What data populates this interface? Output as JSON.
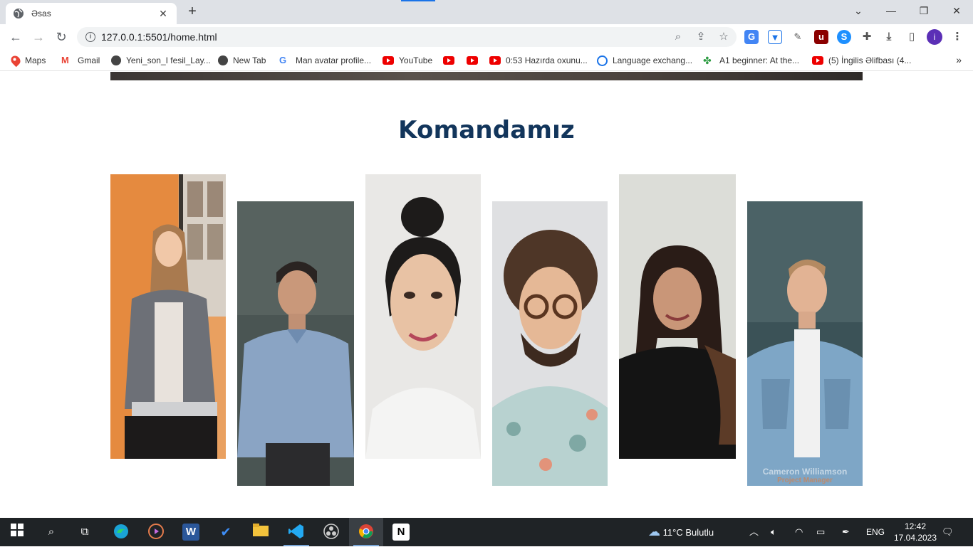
{
  "browser": {
    "tab_title": "Əsas",
    "url": "127.0.0.1:5501/home.html",
    "profile_initial": "i"
  },
  "bookmarks": [
    {
      "label": "Maps",
      "icon": "maps-icon"
    },
    {
      "label": "Gmail",
      "icon": "gmail-icon"
    },
    {
      "label": "Yeni_son_I fesil_Lay...",
      "icon": "globe-icon"
    },
    {
      "label": "New Tab",
      "icon": "globe-icon"
    },
    {
      "label": "Man avatar profile...",
      "icon": "google-icon"
    },
    {
      "label": "YouTube",
      "icon": "youtube-icon"
    },
    {
      "label": "",
      "icon": "youtube-icon"
    },
    {
      "label": "",
      "icon": "youtube-icon"
    },
    {
      "label": "0:53 Hazırda oxunu...",
      "icon": "youtube-icon"
    },
    {
      "label": "Language exchang...",
      "icon": "chat-icon"
    },
    {
      "label": "A1 beginner: At the...",
      "icon": "clover-icon"
    },
    {
      "label": "(5) İngilis Əlifbası (4...",
      "icon": "youtube-icon"
    }
  ],
  "page": {
    "section_title": "Komandamız",
    "team": [
      {
        "icon": "team-photo-woman-1"
      },
      {
        "icon": "team-photo-man-1"
      },
      {
        "icon": "team-photo-woman-2"
      },
      {
        "icon": "team-photo-man-2"
      },
      {
        "icon": "team-photo-woman-3"
      },
      {
        "icon": "team-photo-man-3",
        "name": "Cameron Williamson",
        "role": "Project Manager"
      }
    ]
  },
  "taskbar": {
    "weather": "11°C  Bulutlu",
    "language": "ENG",
    "time": "12:42",
    "date": "17.04.2023"
  },
  "colors": {
    "title": "#12355b",
    "accent": "#1a73e8"
  }
}
